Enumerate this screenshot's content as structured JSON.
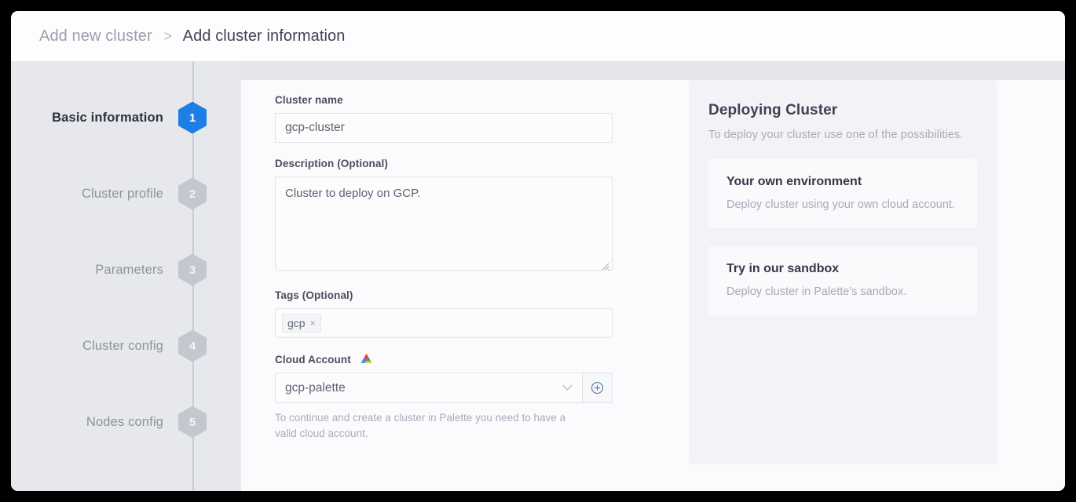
{
  "breadcrumb": {
    "parent": "Add new cluster",
    "separator": ">",
    "current": "Add cluster information"
  },
  "stepper": {
    "steps": [
      {
        "label": "Basic information",
        "number": "1",
        "active": true
      },
      {
        "label": "Cluster profile",
        "number": "2",
        "active": false
      },
      {
        "label": "Parameters",
        "number": "3",
        "active": false
      },
      {
        "label": "Cluster config",
        "number": "4",
        "active": false
      },
      {
        "label": "Nodes config",
        "number": "5",
        "active": false
      }
    ],
    "active_color": "#1d7ee5",
    "inactive_color": "#c4c7cf"
  },
  "form": {
    "cluster_name": {
      "label": "Cluster name",
      "value": "gcp-cluster",
      "placeholder": "Cluster name"
    },
    "description": {
      "label": "Description (Optional)",
      "value": "Cluster to deploy on GCP.",
      "placeholder": "Description"
    },
    "tags": {
      "label": "Tags (Optional)",
      "chips": [
        {
          "text": "gcp",
          "remove": "×"
        }
      ]
    },
    "cloud_account": {
      "label": "Cloud Account",
      "icon": "gcp-cloud-icon",
      "value": "gcp-palette",
      "chevron": "⌄",
      "add_button": "add-circle-icon",
      "helper_text": "To continue and create a cluster in Palette you need to have a valid cloud account."
    }
  },
  "info_panel": {
    "title": "Deploying Cluster",
    "subtitle": "To deploy your cluster use one of the possibilities.",
    "cards": [
      {
        "title": "Your own environment",
        "description": "Deploy cluster using your own cloud account."
      },
      {
        "title": "Try in our sandbox",
        "description": "Deploy cluster in Palette's sandbox."
      }
    ]
  }
}
